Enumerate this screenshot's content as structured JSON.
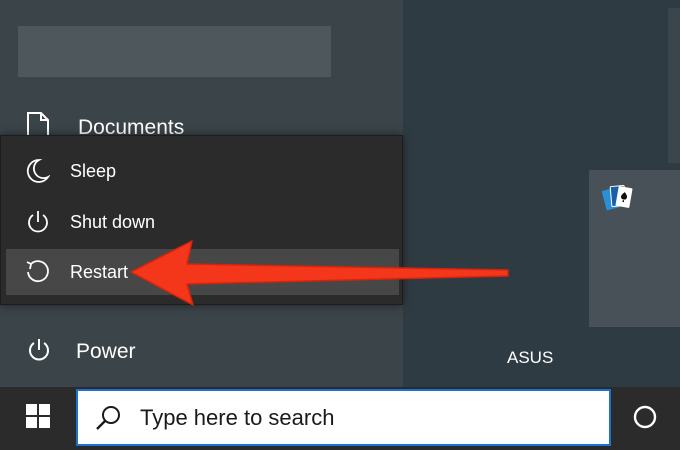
{
  "start_menu": {
    "documents_label": "Documents",
    "power_label": "Power"
  },
  "power_menu": {
    "items": [
      {
        "label": "Sleep",
        "icon": "moon-icon"
      },
      {
        "label": "Shut down",
        "icon": "power-icon"
      },
      {
        "label": "Restart",
        "icon": "restart-icon"
      }
    ]
  },
  "tiles": {
    "asus_label": "ASUS",
    "solitaire_icon": "cards-icon"
  },
  "taskbar": {
    "search_placeholder": "Type here to search"
  },
  "colors": {
    "arrow": "#f4361b",
    "search_border": "#1a73d1",
    "taskbar": "#2b2b2b"
  }
}
